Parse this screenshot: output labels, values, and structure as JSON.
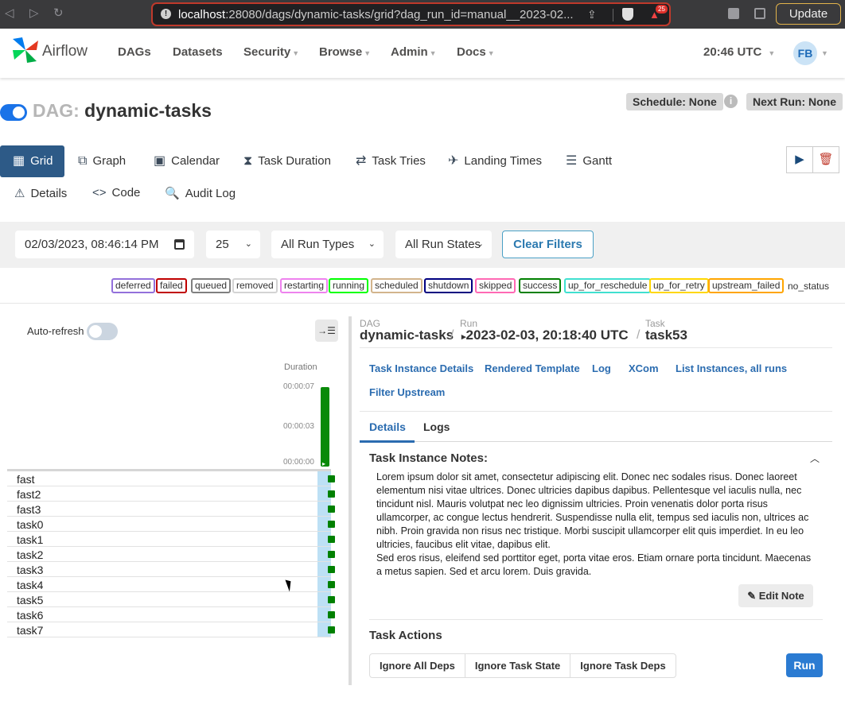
{
  "browser": {
    "url_host": "localhost",
    "url_rest": ":28080/dags/dynamic-tasks/grid?dag_run_id=manual__2023-02...",
    "shields_badge": "25",
    "update_label": "Update"
  },
  "navbar": {
    "brand": "Airflow",
    "items": [
      {
        "label": "DAGs",
        "has_menu": false
      },
      {
        "label": "Datasets",
        "has_menu": false
      },
      {
        "label": "Security",
        "has_menu": true
      },
      {
        "label": "Browse",
        "has_menu": true
      },
      {
        "label": "Admin",
        "has_menu": true
      },
      {
        "label": "Docs",
        "has_menu": true
      }
    ],
    "clock": "20:46 UTC",
    "avatar": "FB"
  },
  "dag": {
    "prefix": "DAG:",
    "name": "dynamic-tasks",
    "schedule": "Schedule: None",
    "next_run": "Next Run: None",
    "paused": false
  },
  "views": {
    "row1": [
      {
        "label": "Grid",
        "icon": "grid-icon",
        "active": true
      },
      {
        "label": "Graph",
        "icon": "graph-icon"
      },
      {
        "label": "Calendar",
        "icon": "calendar-icon"
      },
      {
        "label": "Task Duration",
        "icon": "hourglass-icon"
      },
      {
        "label": "Task Tries",
        "icon": "retry-icon"
      },
      {
        "label": "Landing Times",
        "icon": "landing-icon"
      },
      {
        "label": "Gantt",
        "icon": "gantt-icon"
      }
    ],
    "row2": [
      {
        "label": "Details",
        "icon": "warning-icon"
      },
      {
        "label": "Code",
        "icon": "code-icon"
      },
      {
        "label": "Audit Log",
        "icon": "search-doc-icon"
      }
    ]
  },
  "filters": {
    "date": "02/03/2023, 08:46:14 PM",
    "num_runs": "25",
    "run_type": "All Run Types",
    "run_state": "All Run States",
    "clear_label": "Clear Filters"
  },
  "legend": [
    {
      "label": "deferred",
      "color": "#9370db"
    },
    {
      "label": "failed",
      "color": "#c00000"
    },
    {
      "label": "queued",
      "color": "#808080"
    },
    {
      "label": "removed",
      "color": "#d3d3d3"
    },
    {
      "label": "restarting",
      "color": "#ee82ee"
    },
    {
      "label": "running",
      "color": "#00ff00"
    },
    {
      "label": "scheduled",
      "color": "#d2b48c"
    },
    {
      "label": "shutdown",
      "color": "#000080"
    },
    {
      "label": "skipped",
      "color": "#ff69b4"
    },
    {
      "label": "success",
      "color": "#008000"
    },
    {
      "label": "up_for_reschedule",
      "color": "#40e0d0"
    },
    {
      "label": "up_for_retry",
      "color": "#ffd700"
    },
    {
      "label": "upstream_failed",
      "color": "#ffa500"
    },
    {
      "label": "no_status",
      "color": ""
    }
  ],
  "grid": {
    "auto_refresh_label": "Auto-refresh",
    "duration_label": "Duration",
    "ticks": [
      "00:00:07",
      "00:00:03",
      "00:00:00"
    ],
    "tasks": [
      "fast",
      "fast2",
      "fast3",
      "task0",
      "task1",
      "task2",
      "task3",
      "task4",
      "task5",
      "task6",
      "task7"
    ],
    "task_state_color": "#008000"
  },
  "details": {
    "crumb_dag_label": "DAG",
    "crumb_dag": "dynamic-tasks",
    "crumb_run_label": "Run",
    "crumb_run": "2023-02-03, 20:18:40 UTC",
    "crumb_task_label": "Task",
    "crumb_task": "task53",
    "links": [
      "Task Instance Details",
      "Rendered Template",
      "Log",
      "XCom",
      "List Instances, all runs",
      "Filter Upstream"
    ],
    "tabs": [
      "Details",
      "Logs"
    ],
    "notes_title": "Task Instance Notes:",
    "notes_p1": "Lorem ipsum dolor sit amet, consectetur adipiscing elit. Donec nec sodales risus. Donec laoreet elementum nisi vitae ultrices. Donec ultricies dapibus dapibus. Pellentesque vel iaculis nulla, nec tincidunt nisl. Mauris volutpat nec leo dignissim ultricies. Proin venenatis dolor porta risus ullamcorper, ac congue lectus hendrerit. Suspendisse nulla elit, tempus sed iaculis non, ultrices ac nibh. Proin gravida non risus nec tristique. Morbi suscipit ullamcorper elit quis imperdiet. In eu leo ultricies, faucibus elit vitae, dapibus elit.",
    "notes_p2": "Sed eros risus, eleifend sed porttitor eget, porta vitae eros. Etiam ornare porta tincidunt. Maecenas a metus sapien. Sed et arcu lorem. Duis gravida.",
    "edit_note": "Edit Note",
    "actions_title": "Task Actions",
    "action_buttons": [
      "Ignore All Deps",
      "Ignore Task State",
      "Ignore Task Deps"
    ],
    "run_label": "Run"
  }
}
